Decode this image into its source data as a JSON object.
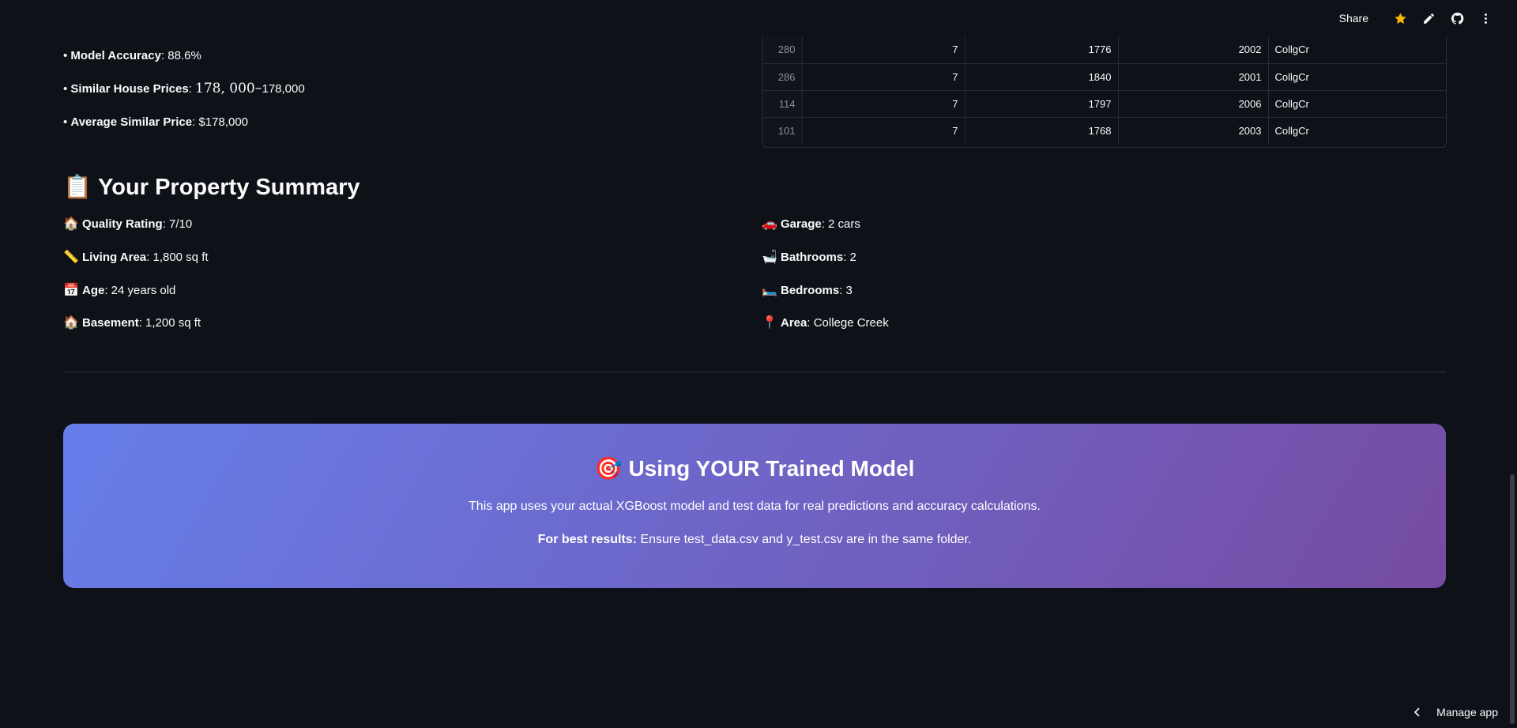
{
  "toolbar": {
    "share_label": "Share",
    "icons": [
      "star-icon",
      "pencil-icon",
      "github-icon",
      "more-vertical-icon"
    ],
    "star_color": "#f5b800"
  },
  "stats": {
    "accuracy_label": "Model Accuracy",
    "accuracy_value": ": 88.6%",
    "similar_label": "Similar House Prices",
    "similar_colon": ": ",
    "similar_math": "178, 000",
    "similar_rest": "−178,000",
    "average_label": "Average Similar Price",
    "average_value": ": $178,000"
  },
  "table": {
    "rows": [
      {
        "idx": "280",
        "quality": "7",
        "area": "1776",
        "year": "2002",
        "hood": "CollgCr"
      },
      {
        "idx": "286",
        "quality": "7",
        "area": "1840",
        "year": "2001",
        "hood": "CollgCr"
      },
      {
        "idx": "114",
        "quality": "7",
        "area": "1797",
        "year": "2006",
        "hood": "CollgCr"
      },
      {
        "idx": "101",
        "quality": "7",
        "area": "1768",
        "year": "2003",
        "hood": "CollgCr"
      }
    ]
  },
  "summary": {
    "title_emoji": "📋",
    "title": "Your Property Summary",
    "left": [
      {
        "emoji": "🏠",
        "label": "Quality Rating",
        "value": ": 7/10"
      },
      {
        "emoji": "📏",
        "label": "Living Area",
        "value": ": 1,800 sq ft"
      },
      {
        "emoji": "📅",
        "label": "Age",
        "value": ": 24 years old"
      },
      {
        "emoji": "🏠",
        "label": "Basement",
        "value": ": 1,200 sq ft"
      }
    ],
    "right": [
      {
        "emoji": "🚗",
        "label": "Garage",
        "value": ": 2 cars"
      },
      {
        "emoji": "🛁",
        "label": "Bathrooms",
        "value": ": 2"
      },
      {
        "emoji": "🛏️",
        "label": "Bedrooms",
        "value": ": 3"
      },
      {
        "emoji": "📍",
        "label": "Area",
        "value": ": College Creek"
      }
    ]
  },
  "banner": {
    "emoji": "🎯",
    "title": "Using YOUR Trained Model",
    "line1": "This app uses your actual XGBoost model and test data for real predictions and accuracy calculations.",
    "line2_bold": "For best results:",
    "line2_rest": " Ensure test_data.csv and y_test.csv are in the same folder.",
    "gradient_start": "#667eea",
    "gradient_end": "#764ba2"
  },
  "footer": {
    "manage_label": "Manage app"
  }
}
